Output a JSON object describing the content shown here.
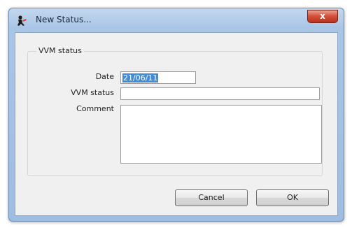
{
  "window": {
    "title": "New Status...",
    "close_glyph": "x"
  },
  "form": {
    "group_label": "VVM status",
    "date_label": "Date",
    "date_value": "21/06/11",
    "vvm_status_label": "VVM status",
    "vvm_status_value": "",
    "comment_label": "Comment",
    "comment_value": ""
  },
  "buttons": {
    "cancel_label": "Cancel",
    "ok_label": "OK"
  },
  "icons": {
    "app": "mSupply-figure-icon",
    "close": "close-icon"
  },
  "colors": {
    "selection": "#3f8cdb",
    "close_button": "#c8402a",
    "titlebar": "#a9c5e6"
  }
}
